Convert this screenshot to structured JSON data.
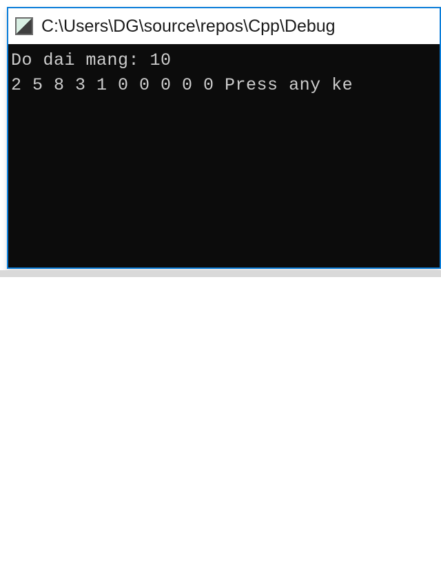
{
  "window": {
    "title_path": "C:\\Users\\DG\\source\\repos\\Cpp\\Debug"
  },
  "console": {
    "line1": "Do dai mang: 10",
    "line2": "2 5 8 3 1 0 0 0 0 0 Press any ke"
  }
}
